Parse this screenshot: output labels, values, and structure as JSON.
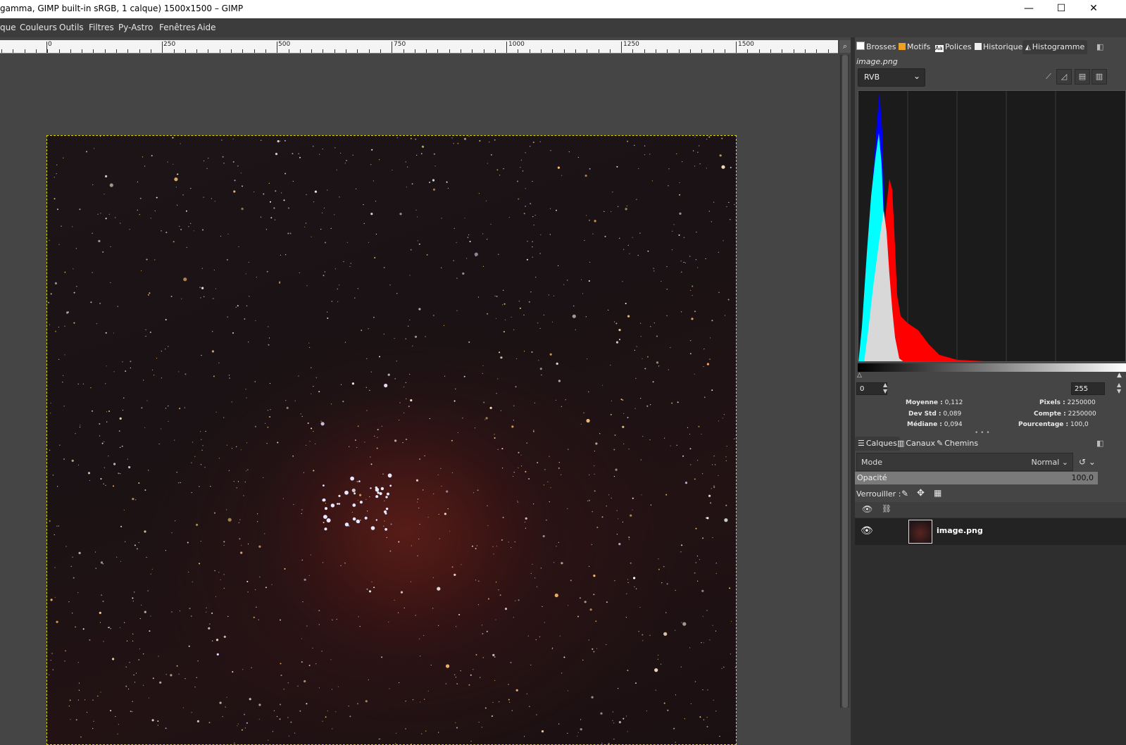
{
  "window": {
    "title": "gamma, GIMP built-in sRGB, 1 calque) 1500x1500 – GIMP",
    "minimize": "—",
    "maximize": "☐",
    "close": "✕"
  },
  "menu": [
    "que",
    "Couleurs",
    "Outils",
    "Filtres",
    "Py-Astro",
    "Fenêtres",
    "Aide"
  ],
  "ruler": {
    "labels": [
      "0",
      "250",
      "500",
      "750",
      "1000",
      "1250",
      "1500"
    ]
  },
  "top_dock": {
    "tabs": [
      "Brosses",
      "Motifs",
      "Polices",
      "Historique",
      "Histogramme"
    ],
    "image_name": "image.png",
    "channel": "RVB",
    "range_min": "0",
    "range_max": "255",
    "stats": {
      "moyenne_label": "Moyenne :",
      "moyenne": "0,112",
      "devstd_label": "Dev Std :",
      "devstd": "0,089",
      "mediane_label": "Médiane :",
      "mediane": "0,094",
      "pixels_label": "Pixels :",
      "pixels": "2250000",
      "compte_label": "Compte :",
      "compte": "2250000",
      "pourcentage_label": "Pourcentage :",
      "pourcentage": "100,0"
    }
  },
  "layers_dock": {
    "tabs": [
      "Calques",
      "Canaux",
      "Chemins"
    ],
    "mode_label": "Mode",
    "mode_value": "Normal",
    "opacity_label": "Opacité",
    "opacity_value": "100,0",
    "lock_label": "Verrouiller :",
    "layers": [
      {
        "name": "image.png",
        "visible": true
      }
    ]
  },
  "colors": {
    "histogram_blue": "#0000ff",
    "histogram_cyan": "#00ffff",
    "histogram_red": "#ff0000",
    "histogram_gray": "#d8d8d8",
    "selection_border": "#d8d800"
  }
}
